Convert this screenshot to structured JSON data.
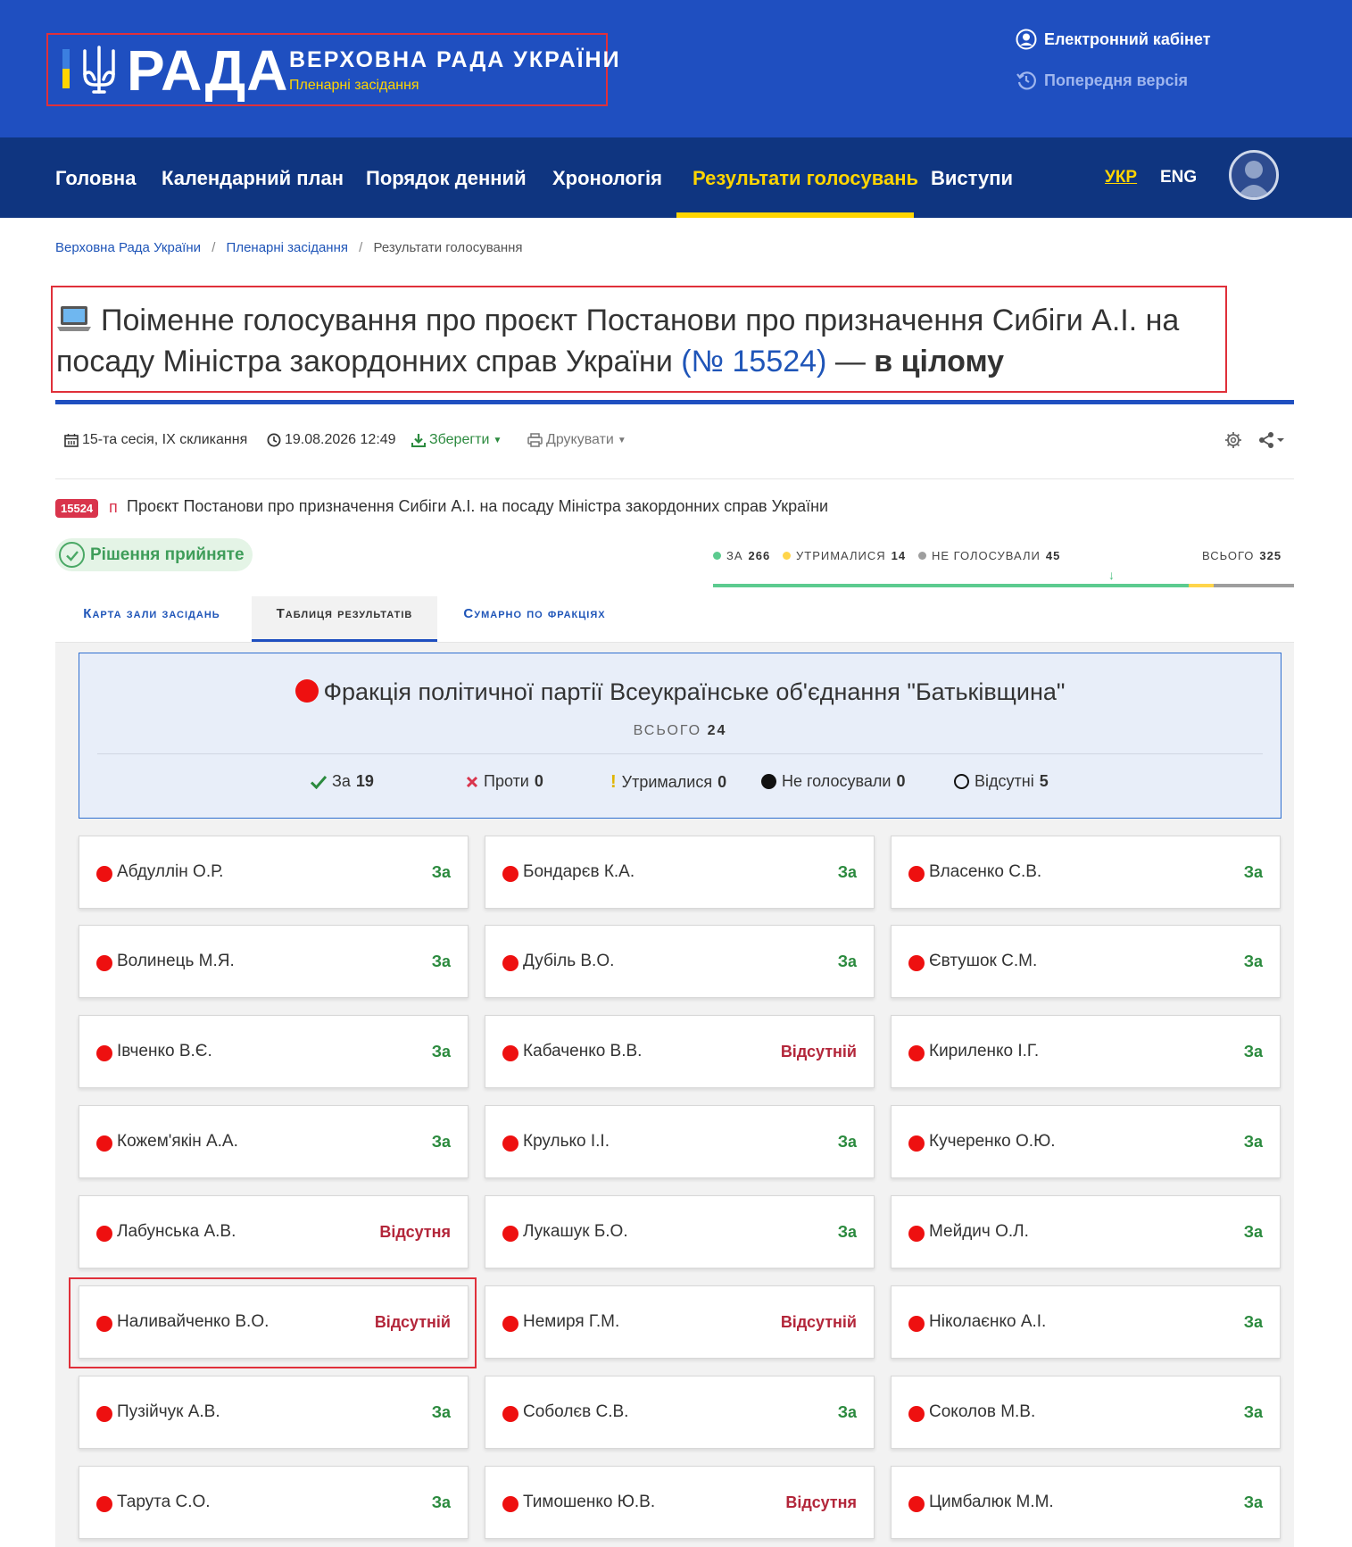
{
  "header": {
    "logo_text": "РАДА",
    "site_title": "ВЕРХОВНА РАДА УКРАЇНИ",
    "site_subtitle": "Пленарні засідання",
    "cabinet_label": "Електронний кабінет",
    "prev_version_label": "Попередня версія"
  },
  "nav": {
    "items": [
      {
        "label": "Головна"
      },
      {
        "label": "Календарний план"
      },
      {
        "label": "Порядок денний"
      },
      {
        "label": "Хронологія"
      },
      {
        "label": "Результати голосувань"
      },
      {
        "label": "Виступи"
      }
    ],
    "lang_ukr": "УКР",
    "lang_eng": "ENG"
  },
  "breadcrumb": {
    "items": [
      "Верховна Рада України",
      "Пленарні засідання",
      "Результати голосування"
    ]
  },
  "title": {
    "main": "Поіменне голосування про проєкт Постанови про призначення Сибіги А.І. на посаду Міністра закордонних справ України",
    "number": "(№ 15524)",
    "dash": "—",
    "suffix": "в цілому"
  },
  "meta": {
    "session": "15-та сесія, IX скликання",
    "datetime": "19.08.2026 12:49",
    "save_label": "Зберегти",
    "print_label": "Друкувати"
  },
  "bill": {
    "number": "15524",
    "type": "п",
    "text": "Проєкт Постанови про призначення Сибіги А.І. на посаду Міністра закордонних справ України"
  },
  "decision": "Рішення прийняте",
  "summary": {
    "za_label": "за",
    "za_value": "266",
    "abstain_label": "утрималися",
    "abstain_value": "14",
    "novote_label": "не голосували",
    "novote_value": "45",
    "total_label": "всього",
    "total_value": "325",
    "colors": {
      "za": "#5ccb8f",
      "abstain": "#ffd54a",
      "novote": "#9e9e9e"
    }
  },
  "tabs": [
    {
      "label": "Карта зали засідань"
    },
    {
      "label": "Таблиця результатів"
    },
    {
      "label": "Сумарно по фракціях"
    }
  ],
  "faction": {
    "name": "Фракція політичної партії Всеукраїнське об'єднання \"Батьківщина\"",
    "total_label": "ВСЬОГО",
    "total_value": "24",
    "stats": {
      "za_label": "За",
      "za_value": "19",
      "against_label": "Проти",
      "against_value": "0",
      "abstain_label": "Утрималися",
      "abstain_value": "0",
      "novote_label": "Не голосували",
      "novote_value": "0",
      "absent_label": "Відсутні",
      "absent_value": "5"
    }
  },
  "deputies": [
    {
      "name": "Абдуллін О.Р.",
      "vote": "За"
    },
    {
      "name": "Бондарєв К.А.",
      "vote": "За"
    },
    {
      "name": "Власенко С.В.",
      "vote": "За"
    },
    {
      "name": "Волинець М.Я.",
      "vote": "За"
    },
    {
      "name": "Дубіль В.О.",
      "vote": "За"
    },
    {
      "name": "Євтушок С.М.",
      "vote": "За"
    },
    {
      "name": "Івченко В.Є.",
      "vote": "За"
    },
    {
      "name": "Кабаченко В.В.",
      "vote": "Відсутній"
    },
    {
      "name": "Кириленко І.Г.",
      "vote": "За"
    },
    {
      "name": "Кожем'якін А.А.",
      "vote": "За"
    },
    {
      "name": "Крулько І.І.",
      "vote": "За"
    },
    {
      "name": "Кучеренко О.Ю.",
      "vote": "За"
    },
    {
      "name": "Лабунська А.В.",
      "vote": "Відсутня"
    },
    {
      "name": "Лукашук Б.О.",
      "vote": "За"
    },
    {
      "name": "Мейдич О.Л.",
      "vote": "За"
    },
    {
      "name": "Наливайченко В.О.",
      "vote": "Відсутній"
    },
    {
      "name": "Немиря Г.М.",
      "vote": "Відсутній"
    },
    {
      "name": "Ніколаєнко А.І.",
      "vote": "За"
    },
    {
      "name": "Пузійчук А.В.",
      "vote": "За"
    },
    {
      "name": "Соболєв С.В.",
      "vote": "За"
    },
    {
      "name": "Соколов М.В.",
      "vote": "За"
    },
    {
      "name": "Тарута С.О.",
      "vote": "За"
    },
    {
      "name": "Тимошенко Ю.В.",
      "vote": "Відсутня"
    },
    {
      "name": "Цимбалюк М.М.",
      "vote": "За"
    }
  ]
}
